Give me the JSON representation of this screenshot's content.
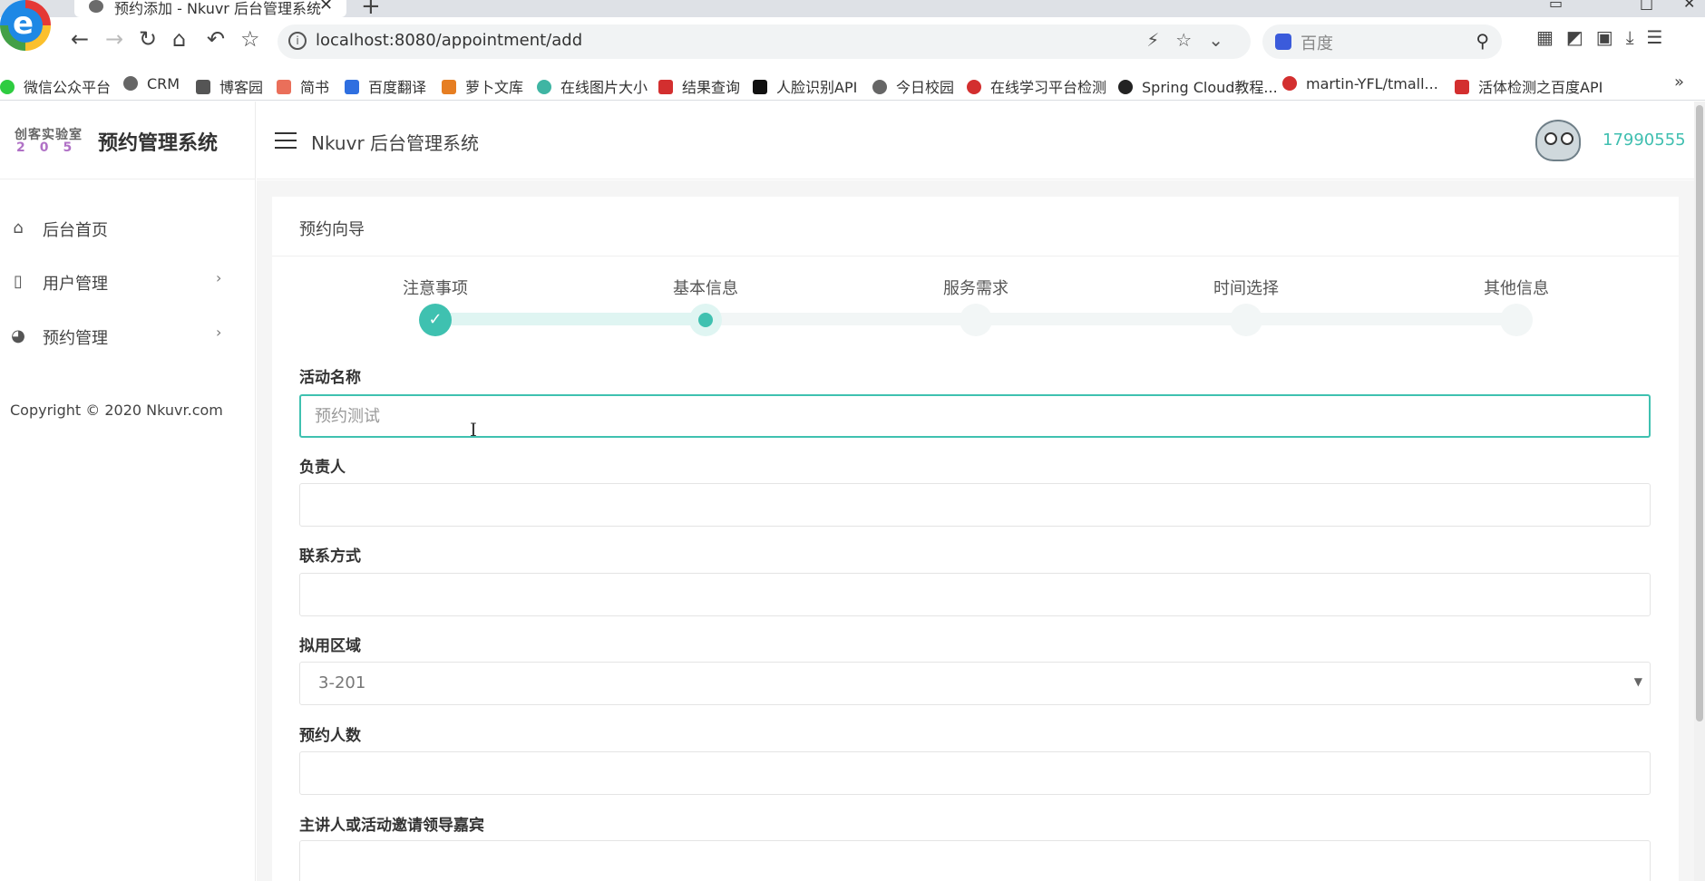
{
  "browser": {
    "tab_title": "预约添加 - Nkuvr 后台管理系统",
    "tab_close": "✕",
    "new_tab": "+",
    "url": "localhost:8080/appointment/add",
    "search_placeholder": "百度",
    "logo_letter": "e",
    "bookmarks": [
      {
        "label": "微信公众平台",
        "color": "#2ecc40"
      },
      {
        "label": "CRM",
        "color": "#666666"
      },
      {
        "label": "博客园",
        "color": "#555555"
      },
      {
        "label": "简书",
        "color": "#ea6f5a"
      },
      {
        "label": "百度翻译",
        "color": "#2f6fe0"
      },
      {
        "label": "萝卜文库",
        "color": "#e67e22"
      },
      {
        "label": "在线图片大小",
        "color": "#3fb5a3"
      },
      {
        "label": "结果查询",
        "color": "#d32f2f"
      },
      {
        "label": "人脸识别API",
        "color": "#111111"
      },
      {
        "label": "今日校园",
        "color": "#666666"
      },
      {
        "label": "在线学习平台检测",
        "color": "#d32f2f"
      },
      {
        "label": "Spring Cloud教程...",
        "color": "#222222"
      },
      {
        "label": "martin-YFL/tmall...",
        "color": "#d32f2f"
      },
      {
        "label": "活体检测之百度API",
        "color": "#d32f2f"
      }
    ],
    "bookmarks_more": "»"
  },
  "sidebar": {
    "brand_logo_top": "创客实验室",
    "brand_logo_num": "205",
    "brand_name": "预约管理系统",
    "items": [
      {
        "label": "后台首页",
        "icon": "home-icon",
        "glyph": "⌂"
      },
      {
        "label": "用户管理",
        "icon": "file-icon",
        "glyph": "▯",
        "caret": "›"
      },
      {
        "label": "预约管理",
        "icon": "palette-icon",
        "glyph": "◕",
        "caret": "›"
      }
    ],
    "copyright": "Copyright © 2020 Nkuvr.com"
  },
  "topbar": {
    "title": "Nkuvr 后台管理系统",
    "username": "17990555"
  },
  "card": {
    "title": "预约向导"
  },
  "wizard": {
    "steps": [
      "注意事项",
      "基本信息",
      "服务需求",
      "时间选择",
      "其他信息"
    ],
    "current_step": 2,
    "done_mark": "✓"
  },
  "form": {
    "activity_name": {
      "label": "活动名称",
      "placeholder": "预约测试",
      "value": ""
    },
    "owner": {
      "label": "负责人",
      "value": ""
    },
    "contact": {
      "label": "联系方式",
      "value": ""
    },
    "area": {
      "label": "拟用区域",
      "value": "3-201",
      "arrow": "▼"
    },
    "people_count": {
      "label": "预约人数",
      "value": ""
    },
    "guests": {
      "label": "主讲人或活动邀请领导嘉宾",
      "value": ""
    }
  },
  "colors": {
    "accent": "#3fc1b0",
    "step_done_track": "#dff5f2",
    "username": "#3fbfb0"
  }
}
